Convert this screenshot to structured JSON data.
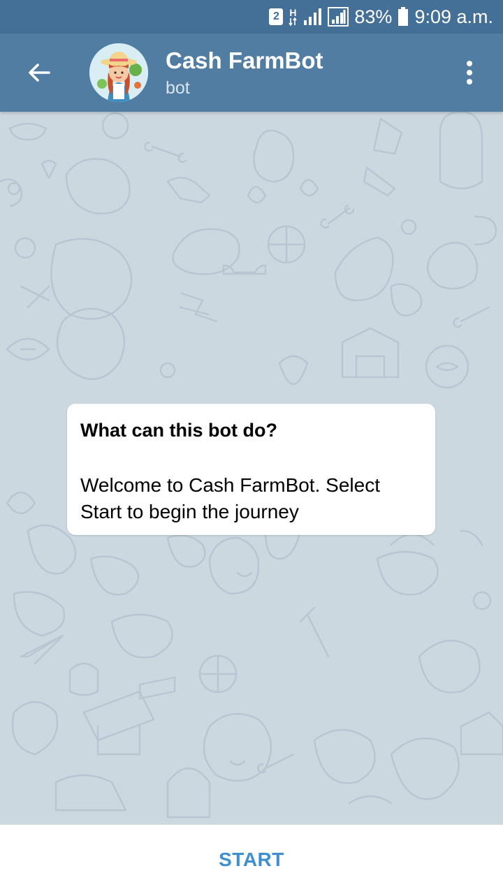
{
  "status_bar": {
    "sim_label": "2",
    "network_label": "H",
    "battery_percent": "83%",
    "time": "9:09 a.m.",
    "icons": [
      "sim-2-icon",
      "network-h-icon",
      "signal-icon",
      "signal-2-icon",
      "battery-icon"
    ]
  },
  "header": {
    "title": "Cash FarmBot",
    "subtitle": "bot",
    "icons": [
      "back-arrow-icon",
      "avatar",
      "more-vertical-icon"
    ]
  },
  "info_card": {
    "title": "What can this bot do?",
    "text": "Welcome to Cash FarmBot. Select Start to begin the journey"
  },
  "bottom_bar": {
    "start_label": "START"
  },
  "colors": {
    "status_bar": "#446f96",
    "header": "#527da3",
    "chat_background": "#ccd8e0",
    "accent": "#3d8fd1"
  }
}
